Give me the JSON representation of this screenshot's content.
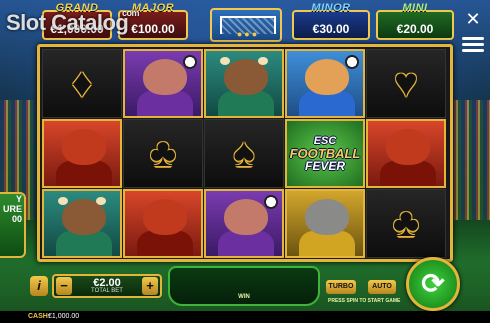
{
  "watermark": {
    "text": "Slot Catalog",
    "domain": "com"
  },
  "jackpots": {
    "grand": {
      "label": "GRAND",
      "value": "€1,000.00"
    },
    "major": {
      "label": "MAJOR",
      "value": "€100.00"
    },
    "minor": {
      "label": "MINOR",
      "value": "€30.00"
    },
    "mini": {
      "label": "MINI",
      "value": "€20.00"
    }
  },
  "header": {
    "close_icon": "✕",
    "menu_icon": "hamburger-menu-icon"
  },
  "reels": [
    [
      "diamond",
      "boar",
      "bull",
      "lynx",
      "heart"
    ],
    [
      "rooster",
      "club",
      "spade",
      "feature-logo",
      "rooster"
    ],
    [
      "bull",
      "rooster",
      "boar",
      "wolf",
      "club"
    ]
  ],
  "symbols": {
    "diamond": "♦",
    "heart": "♥",
    "club": "♣",
    "spade": "♠"
  },
  "feature_logo": {
    "line1": "ESC",
    "line2": "FOOTBALL",
    "line3": "FEVER"
  },
  "side_panel": {
    "line1": "Y",
    "line2": "URE",
    "line3": "00"
  },
  "controls": {
    "info": "i",
    "bet_minus": "−",
    "bet_plus": "+",
    "bet_value": "€2.00",
    "bet_label": "TOTAL BET",
    "win_label": "WIN",
    "turbo": "TURBO",
    "auto": "AUTO",
    "spin_hint": "PRESS SPIN TO START GAME",
    "spin_icon": "⟳"
  },
  "cash": {
    "label": "CASH:",
    "value": "€1,000.00"
  },
  "colors": {
    "gold": "#e3b53a",
    "spin_green": "#3fd13f"
  }
}
